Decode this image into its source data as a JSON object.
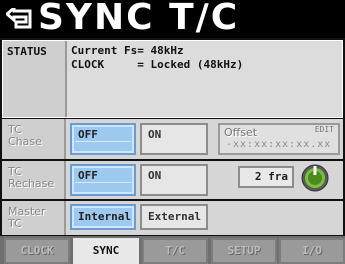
{
  "title": "SYNC T/C",
  "status": {
    "label": "STATUS",
    "line1": "Current Fs= 48kHz",
    "line2": "CLOCK     = Locked (48kHz)"
  },
  "tc_chase": {
    "label_line1": "TC",
    "label_line2": "Chase",
    "off_label": "OFF",
    "on_label": "ON",
    "selected": "OFF",
    "offset_label": "Offset",
    "edit_label": "EDIT",
    "offset_value": "-xx:xx:xx:xx.xx"
  },
  "tc_rechase": {
    "label_line1": "TC",
    "label_line2": "Rechase",
    "off_label": "OFF",
    "on_label": "ON",
    "selected": "OFF",
    "frames_value": "2 fra"
  },
  "master_tc": {
    "label_line1": "Master",
    "label_line2": "TC",
    "internal_label": "Internal",
    "external_label": "External",
    "selected": "Internal"
  },
  "tabs": [
    {
      "label": "CLOCK",
      "active": false
    },
    {
      "label": "SYNC",
      "active": true
    },
    {
      "label": "T/C",
      "active": false
    },
    {
      "label": "SETUP",
      "active": false
    },
    {
      "label": "I/O",
      "active": false
    }
  ],
  "colors": {
    "active_button": "#9ec9ee",
    "title_bar": "#000000",
    "panel": "#d6d6d6"
  }
}
